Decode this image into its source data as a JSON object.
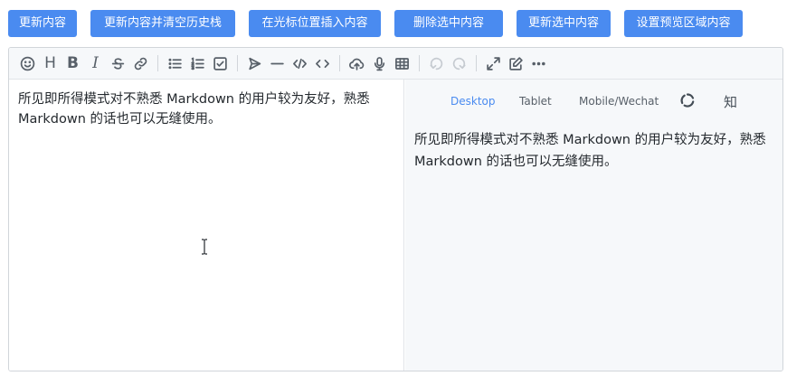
{
  "actions": [
    {
      "label": "更新内容"
    },
    {
      "label": "更新内容并清空历史栈"
    },
    {
      "label": "在光标位置插入内容"
    },
    {
      "label": "删除选中内容"
    },
    {
      "label": "更新选中内容"
    },
    {
      "label": "设置预览区域内容"
    }
  ],
  "toolbar": {
    "heading_glyph": "H",
    "bold_glyph": "B",
    "italic_glyph": "I",
    "icons": [
      "emoji-icon",
      "heading-icon",
      "bold-icon",
      "italic-icon",
      "strikethrough-icon",
      "link-icon",
      "unordered-list-icon",
      "ordered-list-icon",
      "check-list-icon",
      "quote-icon",
      "horizontal-rule-icon",
      "inline-code-icon",
      "code-block-icon",
      "upload-icon",
      "record-icon",
      "table-icon",
      "undo-icon",
      "redo-icon",
      "fullscreen-icon",
      "edit-mode-icon",
      "more-icon"
    ]
  },
  "editor": {
    "content": "所见即所得模式对不熟悉 Markdown 的用户较为友好，熟悉 Markdown 的话也可以无缝使用。"
  },
  "preview": {
    "tabs": [
      {
        "label": "Desktop",
        "active": true
      },
      {
        "label": "Tablet",
        "active": false
      },
      {
        "label": "Mobile/Wechat",
        "active": false
      }
    ],
    "zhihu_label": "知",
    "content": "所见即所得模式对不熟悉 Markdown 的用户较为友好，熟悉 Markdown 的话也可以无缝使用。"
  },
  "colors": {
    "accent": "#4a8bf0",
    "toolbar_bg": "#f6f8fa",
    "icon": "#586069"
  }
}
